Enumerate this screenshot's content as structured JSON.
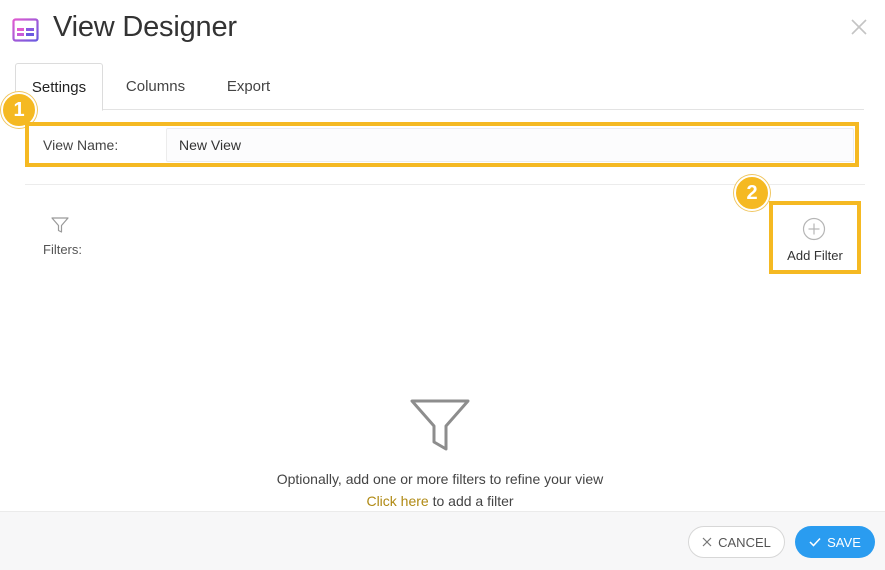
{
  "dialog": {
    "title": "View Designer",
    "icon": "view-designer-icon",
    "close_icon": "close-icon"
  },
  "tabs": [
    {
      "label": "Settings",
      "active": true
    },
    {
      "label": "Columns",
      "active": false
    },
    {
      "label": "Export",
      "active": false
    }
  ],
  "markers": [
    "1",
    "2"
  ],
  "view_name": {
    "label": "View Name:",
    "value": "New View"
  },
  "filters": {
    "label": "Filters:",
    "icon": "funnel-icon",
    "add_label": "Add Filter",
    "add_icon": "plus-circle-icon"
  },
  "empty_state": {
    "icon": "funnel-icon",
    "message": "Optionally, add one or more filters to refine your view",
    "link_text": "Click here",
    "link_suffix": " to add a filter"
  },
  "footer": {
    "cancel_label": "CANCEL",
    "save_label": "SAVE"
  },
  "colors": {
    "highlight": "#f5b922",
    "primary": "#2a9cf0",
    "link": "#b08a14"
  }
}
